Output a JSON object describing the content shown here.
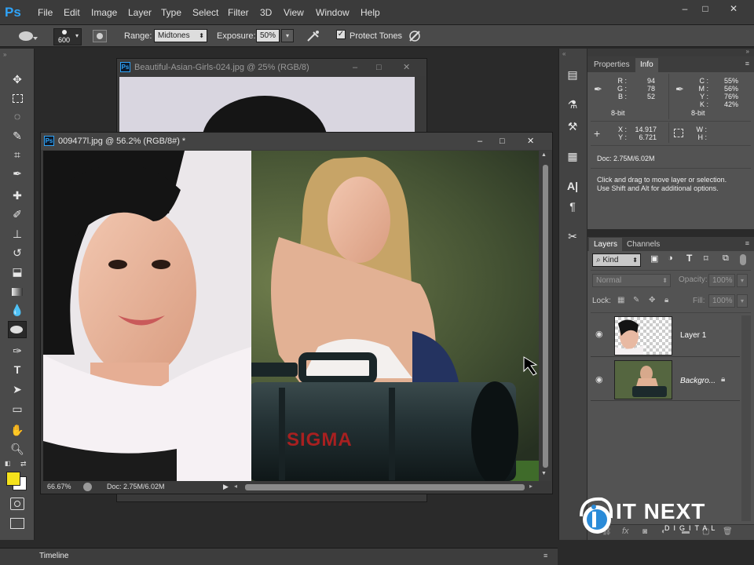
{
  "app": {
    "logo": "Ps"
  },
  "menu": [
    "File",
    "Edit",
    "Image",
    "Layer",
    "Type",
    "Select",
    "Filter",
    "3D",
    "View",
    "Window",
    "Help"
  ],
  "window_controls": {
    "minimize": "–",
    "maximize": "□",
    "close": "✕"
  },
  "options": {
    "brush_size": "600",
    "range_label": "Range:",
    "range_value": "Midtones",
    "exposure_label": "Exposure:",
    "exposure_value": "50%",
    "protect_tones": "Protect Tones"
  },
  "doc_back": {
    "title": "Beautiful-Asian-Girls-024.jpg @ 25% (RGB/8)"
  },
  "doc_front": {
    "title": "009477l.jpg @ 56.2% (RGB/8#) *",
    "zoom": "66.67%",
    "doc_size": "Doc: 2.75M/6.02M",
    "lens_text": "SIGMA"
  },
  "panel_tabs": {
    "properties": "Properties",
    "info": "Info"
  },
  "info": {
    "rgb_labels": [
      "R :",
      "G :",
      "B :"
    ],
    "rgb_values": [
      "94",
      "78",
      "52"
    ],
    "bit_left": "8-bit",
    "cmyk_labels": [
      "C :",
      "M :",
      "Y :",
      "K :"
    ],
    "cmyk_values": [
      "55%",
      "56%",
      "76%",
      "42%"
    ],
    "bit_right": "8-bit",
    "xy_labels": [
      "X :",
      "Y :"
    ],
    "xy_values": [
      "14.917",
      "6.721"
    ],
    "wh_labels": [
      "W :",
      "H :"
    ],
    "doc": "Doc: 2.75M/6.02M",
    "hint1": "Click and drag to move layer or selection.",
    "hint2": "Use Shift and Alt for additional options."
  },
  "layers_tabs": {
    "layers": "Layers",
    "channels": "Channels"
  },
  "layers_panel": {
    "kind": "Kind",
    "blend": "Normal",
    "opacity_label": "Opacity:",
    "opacity_value": "100%",
    "lock_label": "Lock:",
    "fill_label": "Fill:",
    "fill_value": "100%"
  },
  "layers": [
    {
      "name": "Layer 1"
    },
    {
      "name": "Backgro..."
    }
  ],
  "timeline": {
    "label": "Timeline"
  },
  "watermark": {
    "line1": "IT NEXT",
    "line2": "DIGITAL"
  },
  "colors": {
    "accent": "#2fa3f7",
    "foreground": "#f5e21c",
    "background": "#ffffff"
  }
}
